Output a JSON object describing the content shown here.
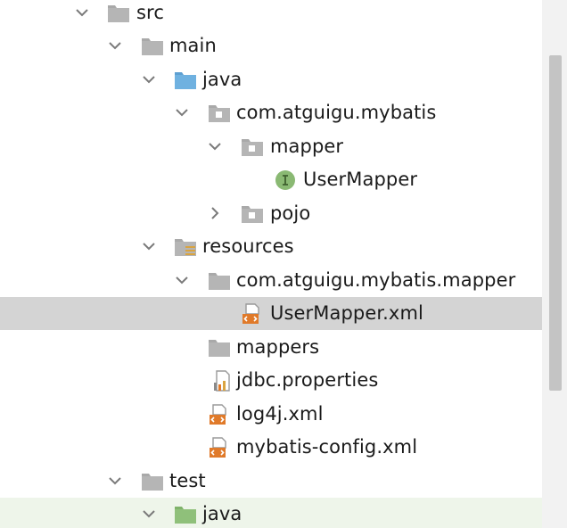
{
  "tree": {
    "nodes": [
      {
        "label": "src"
      },
      {
        "label": "main"
      },
      {
        "label": "java"
      },
      {
        "label": "com.atguigu.mybatis"
      },
      {
        "label": "mapper"
      },
      {
        "label": "UserMapper",
        "badge": "I"
      },
      {
        "label": "pojo"
      },
      {
        "label": "resources"
      },
      {
        "label": "com.atguigu.mybatis.mapper"
      },
      {
        "label": "UserMapper.xml",
        "badge": "<>"
      },
      {
        "label": "mappers"
      },
      {
        "label": "jdbc.properties"
      },
      {
        "label": "log4j.xml",
        "badge": "<>"
      },
      {
        "label": "mybatis-config.xml",
        "badge": "<>"
      },
      {
        "label": "test"
      },
      {
        "label": "java"
      }
    ]
  },
  "colors": {
    "selection": "#d4d4d4",
    "folder_gray": "#a9a9a9",
    "source_root_blue": "#6fb1e0",
    "test_root_green": "#8fc07a",
    "interface_badge_green": "#8ab973",
    "xml_orange": "#e07a2a"
  }
}
